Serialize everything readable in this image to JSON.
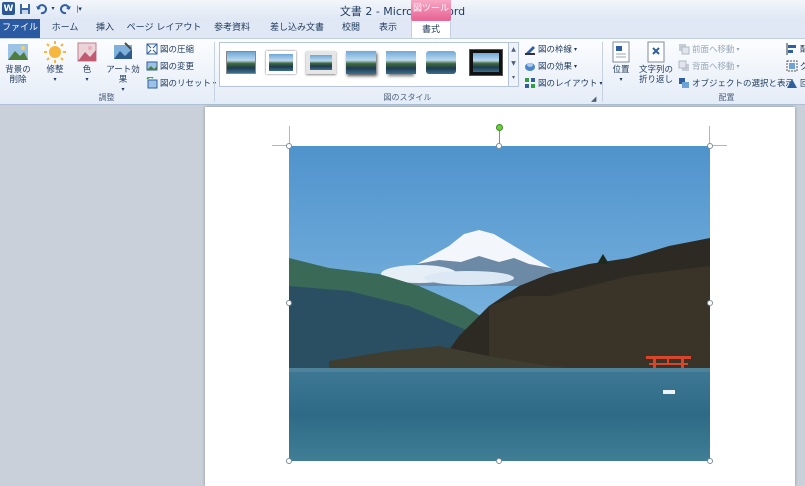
{
  "window": {
    "title": "文書 2 - Microsoft Word",
    "context_tool": "図ツール"
  },
  "tabs": [
    {
      "label": "ファイル"
    },
    {
      "label": "ホーム"
    },
    {
      "label": "挿入"
    },
    {
      "label": "ページ レイアウト"
    },
    {
      "label": "参考資料"
    },
    {
      "label": "差し込み文書"
    },
    {
      "label": "校閲"
    },
    {
      "label": "表示"
    },
    {
      "label": "書式"
    }
  ],
  "ribbon": {
    "adjust": {
      "remove_bg": "背景の\n削除",
      "remove_bg_l1": "背景の",
      "remove_bg_l2": "削除",
      "corrections": "修整",
      "color": "色",
      "art_effects": "アート効果",
      "compress": "図の圧縮",
      "change": "図の変更",
      "reset": "図のリセット",
      "group_label": "調整"
    },
    "styles": {
      "border": "図の枠線",
      "effects": "図の効果",
      "layout": "図のレイアウト",
      "group_label": "図のスタイル"
    },
    "arrange": {
      "position": "位置",
      "wrap_l1": "文字列の",
      "wrap_l2": "折り返し",
      "bring_forward": "前面へ移動",
      "send_backward": "背面へ移動",
      "selection_pane": "オブジェクトの選択と表示",
      "align_partial": "配",
      "group_partial": "グ",
      "rotate_partial": "回",
      "group_label": "配置"
    }
  },
  "colors": {
    "accent_pink": "#e86796",
    "file_tab": "#2a5aa2",
    "ribbon_text": "#1e395b"
  }
}
